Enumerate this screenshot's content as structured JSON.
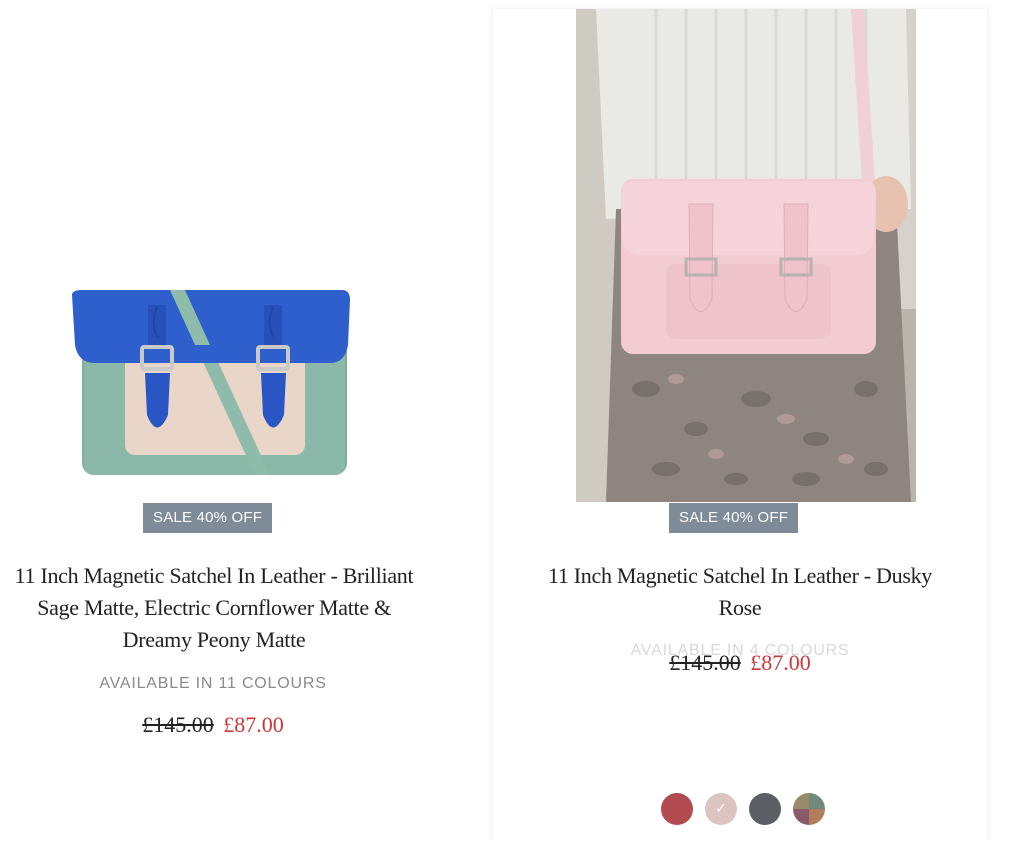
{
  "products": [
    {
      "badge": "SALE 40% OFF",
      "title": "11 Inch Magnetic Satchel In Leather - Brilliant Sage Matte, Electric Cornflower Matte & Dreamy Peony Matte",
      "availability": "AVAILABLE IN 11 COLOURS",
      "old_price": "£145.00",
      "new_price": "£87.00"
    },
    {
      "badge": "SALE 40% OFF",
      "title": "11 Inch Magnetic Satchel In Leather - Dusky Rose",
      "availability": "AVAILABLE IN 4 COLOURS",
      "old_price": "£145.00",
      "new_price": "£87.00",
      "swatches": [
        {
          "name": "red",
          "color": "#b24a4f",
          "selected": false
        },
        {
          "name": "dusky-rose",
          "color": "#dcc5c0",
          "selected": true
        },
        {
          "name": "grey",
          "color": "#5b5e63",
          "selected": false
        },
        {
          "name": "multi",
          "color": "#8a7455",
          "selected": false
        }
      ]
    }
  ],
  "colors": {
    "badge_bg": "#7e8b98",
    "sale_price": "#d0353a",
    "text": "#222222",
    "muted": "#8a8a8a"
  },
  "icons": {
    "selected_swatch": "check-icon"
  }
}
